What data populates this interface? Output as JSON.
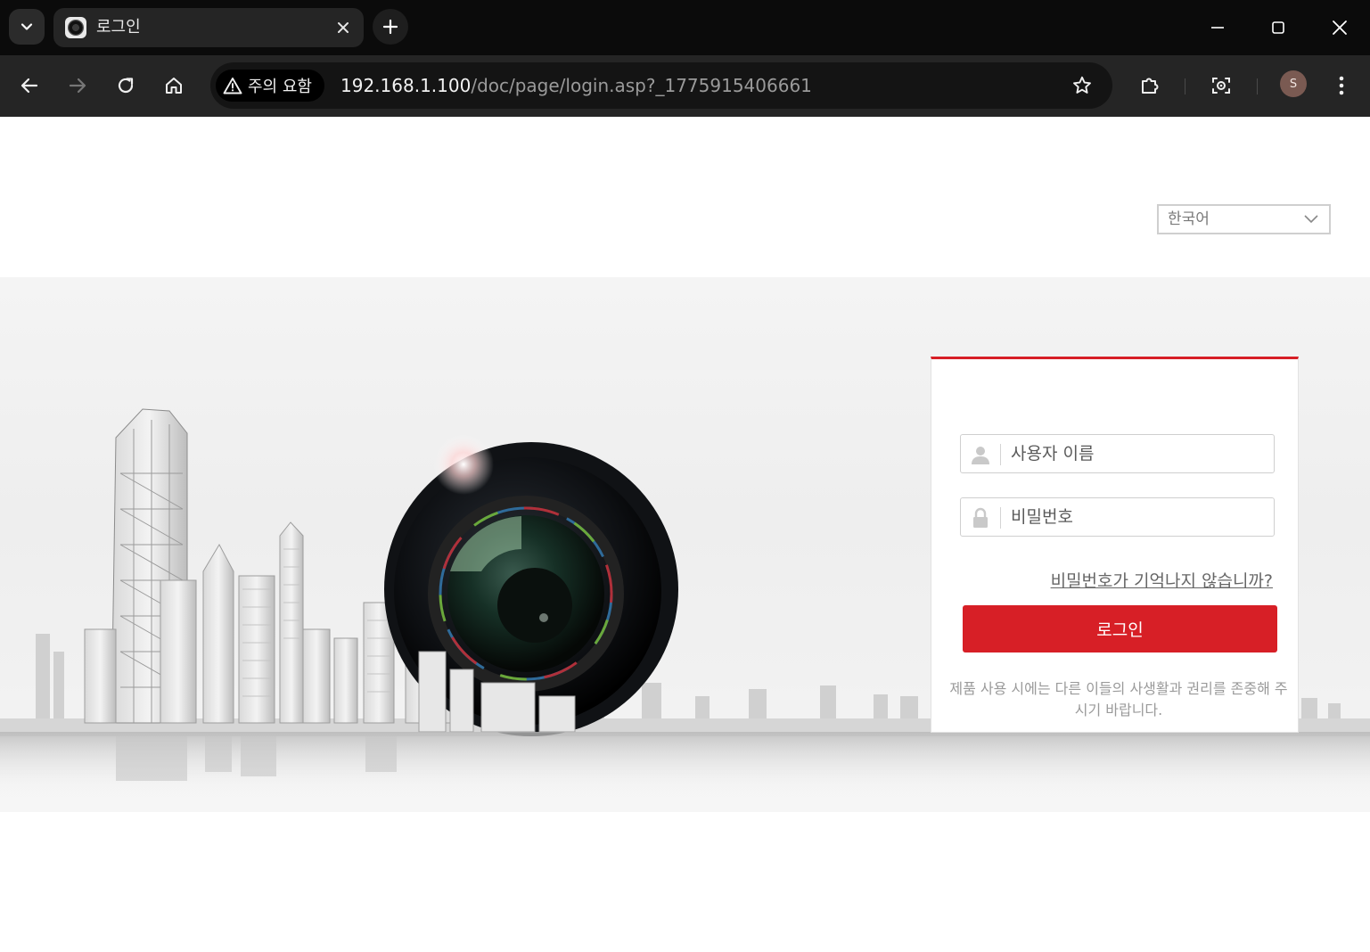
{
  "browser": {
    "tab": {
      "title": "로그인",
      "favicon": "camera-lens-icon"
    },
    "security_chip": "주의 요함",
    "url_host": "192.168.1.100",
    "url_path": "/doc/page/login.asp?_1775915406661",
    "profile_initial": "S",
    "colors": {
      "tabstrip": "#0b0b0b",
      "toolbar": "#252525",
      "omnibox": "#141414"
    }
  },
  "page": {
    "language": {
      "selected": "한국어"
    },
    "login": {
      "username_placeholder": "사용자 이름",
      "password_placeholder": "비밀번호",
      "forgot_link": "비밀번호가 기억나지 않습니까?",
      "login_button": "로그인",
      "notice": "제품 사용 시에는 다른 이들의 사생활과 권리를 존중해 주시기 바랍니다."
    },
    "colors": {
      "accent": "#d71f26",
      "placeholder": "#5a5a5a",
      "muted": "#9a9a9a"
    }
  }
}
